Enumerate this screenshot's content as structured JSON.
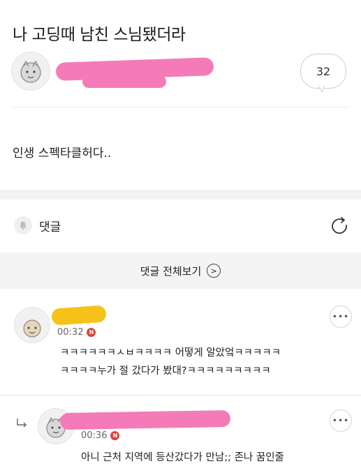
{
  "post": {
    "title": "나 고딩때 남친 스님됐더라",
    "comment_count": "32",
    "body": "인생 스펙타클허다.."
  },
  "comments_section": {
    "label": "댓글",
    "view_all_label": "댓글 전체보기"
  },
  "comments": [
    {
      "time": "00:32",
      "badge": "N",
      "lines": [
        "ㅋㅋㅋㅋㅋㅋㅅㅂㅋㅋㅋㅋ 어떻게 알았엌ㅋㅋㅋㅋㅋ",
        "ㅋㅋㅋㅋ누가 절 갔다가 봤대?ㅋㅋㅋㅋㅋㅋㅋㅋㅋ"
      ]
    },
    {
      "time": "00:36",
      "badge": "N",
      "lines": [
        "아니 근처 지역에 등산갔다가 만남;; 존나 꿈인줄"
      ]
    }
  ],
  "colors": {
    "redaction_pink": "#f47bb8",
    "redaction_yellow": "#f5c21a",
    "new_badge": "#e0403a",
    "band_gray": "#f2f2f2"
  },
  "icons": {
    "bell": "bell-icon",
    "refresh": "refresh-icon",
    "more": "more-icon",
    "reply": "reply-arrow-icon",
    "chevron": "chevron-right-icon"
  }
}
